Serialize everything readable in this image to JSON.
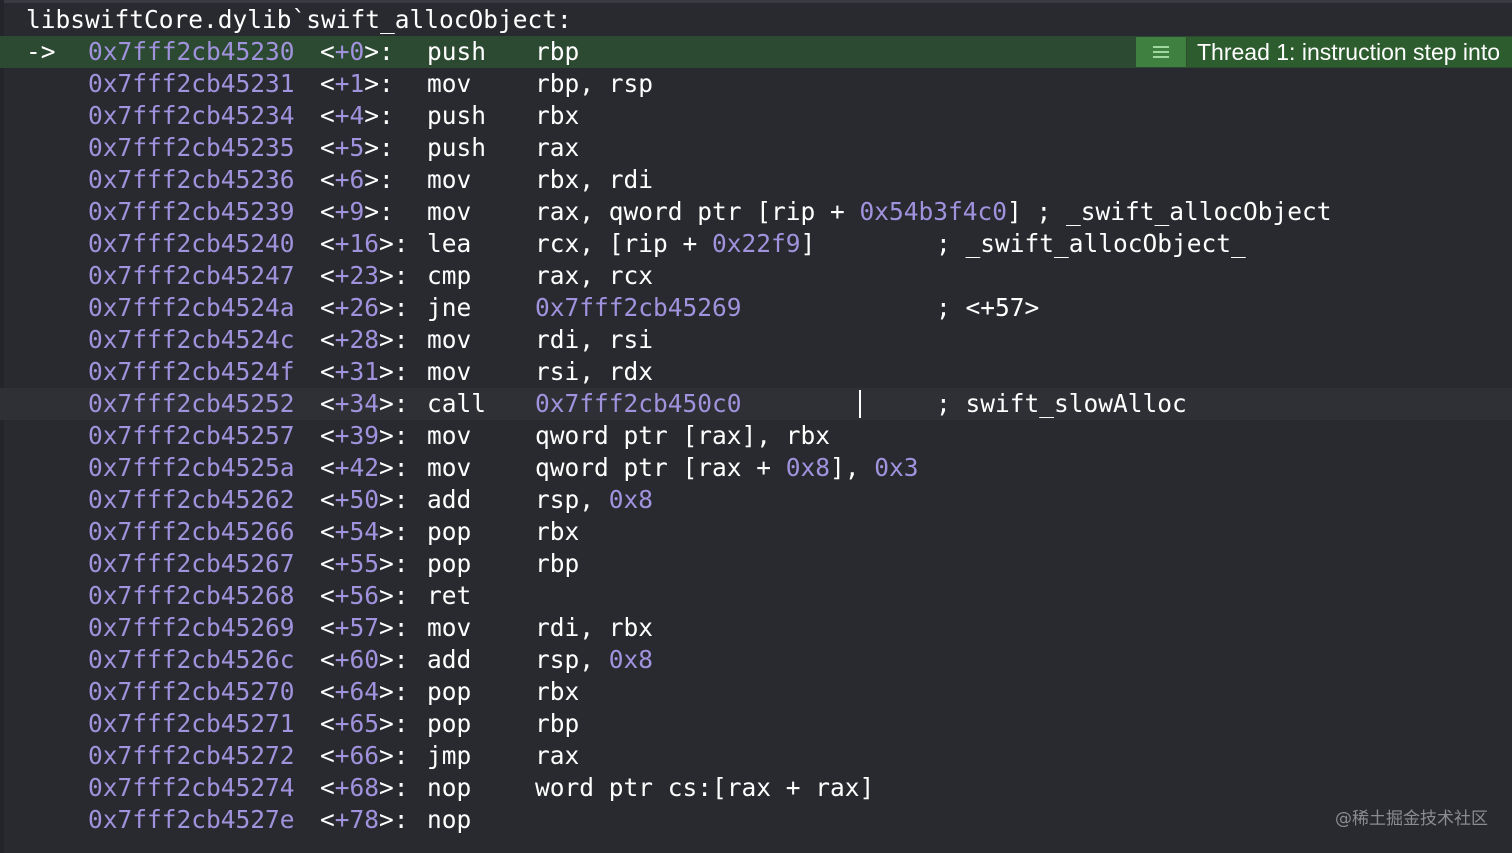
{
  "header": {
    "symbol": "libswiftCore.dylib`swift_allocObject:"
  },
  "badge": {
    "icon": "list-icon",
    "text": "Thread 1: instruction step into"
  },
  "pc_arrow": "->",
  "colors": {
    "background": "#292a30",
    "number": "#a092dd",
    "pc_line": "#2c4a32",
    "badge": "#2d5d2e",
    "current_line": "#2f3036"
  },
  "lines": [
    {
      "addr": "0x7fff2cb45230",
      "lt": "<",
      "off": "+0",
      "gt": ">:",
      "mn": "push",
      "ops": [
        [
          "rbp",
          0
        ]
      ],
      "cmt": ""
    },
    {
      "addr": "0x7fff2cb45231",
      "lt": "<",
      "off": "+1",
      "gt": ">:",
      "mn": "mov",
      "ops": [
        [
          "rbp, rsp",
          0
        ]
      ],
      "cmt": ""
    },
    {
      "addr": "0x7fff2cb45234",
      "lt": "<",
      "off": "+4",
      "gt": ">:",
      "mn": "push",
      "ops": [
        [
          "rbx",
          0
        ]
      ],
      "cmt": ""
    },
    {
      "addr": "0x7fff2cb45235",
      "lt": "<",
      "off": "+5",
      "gt": ">:",
      "mn": "push",
      "ops": [
        [
          "rax",
          0
        ]
      ],
      "cmt": ""
    },
    {
      "addr": "0x7fff2cb45236",
      "lt": "<",
      "off": "+6",
      "gt": ">:",
      "mn": "mov",
      "ops": [
        [
          "rbx, rdi",
          0
        ]
      ],
      "cmt": ""
    },
    {
      "addr": "0x7fff2cb45239",
      "lt": "<",
      "off": "+9",
      "gt": ">:",
      "mn": "mov",
      "ops": [
        [
          "rax, qword ptr [rip + ",
          0
        ],
        [
          "0x54b3f4c0",
          1
        ],
        [
          "] ; _swift_allocObject",
          0
        ]
      ],
      "cmt": ""
    },
    {
      "addr": "0x7fff2cb45240",
      "lt": "<",
      "off": "+16",
      "gt": ">:",
      "mn": "lea",
      "ops": [
        [
          "rcx, [rip + ",
          0
        ],
        [
          "0x22f9",
          1
        ],
        [
          "]",
          0
        ]
      ],
      "cmt": "; _swift_allocObject_"
    },
    {
      "addr": "0x7fff2cb45247",
      "lt": "<",
      "off": "+23",
      "gt": ">:",
      "mn": "cmp",
      "ops": [
        [
          "rax, rcx",
          0
        ]
      ],
      "cmt": ""
    },
    {
      "addr": "0x7fff2cb4524a",
      "lt": "<",
      "off": "+26",
      "gt": ">:",
      "mn": "jne",
      "ops": [
        [
          "0x7fff2cb45269",
          1
        ]
      ],
      "cmt": "; <+57>"
    },
    {
      "addr": "0x7fff2cb4524c",
      "lt": "<",
      "off": "+28",
      "gt": ">:",
      "mn": "mov",
      "ops": [
        [
          "rdi, rsi",
          0
        ]
      ],
      "cmt": ""
    },
    {
      "addr": "0x7fff2cb4524f",
      "lt": "<",
      "off": "+31",
      "gt": ">:",
      "mn": "mov",
      "ops": [
        [
          "rsi, rdx",
          0
        ]
      ],
      "cmt": ""
    },
    {
      "addr": "0x7fff2cb45252",
      "lt": "<",
      "off": "+34",
      "gt": ">:",
      "mn": "call",
      "ops": [
        [
          "0x7fff2cb450c0",
          1
        ]
      ],
      "cmt": "; swift_slowAlloc"
    },
    {
      "addr": "0x7fff2cb45257",
      "lt": "<",
      "off": "+39",
      "gt": ">:",
      "mn": "mov",
      "ops": [
        [
          "qword ptr [rax], rbx",
          0
        ]
      ],
      "cmt": ""
    },
    {
      "addr": "0x7fff2cb4525a",
      "lt": "<",
      "off": "+42",
      "gt": ">:",
      "mn": "mov",
      "ops": [
        [
          "qword ptr [rax + ",
          0
        ],
        [
          "0x8",
          1
        ],
        [
          "], ",
          0
        ],
        [
          "0x3",
          1
        ]
      ],
      "cmt": ""
    },
    {
      "addr": "0x7fff2cb45262",
      "lt": "<",
      "off": "+50",
      "gt": ">:",
      "mn": "add",
      "ops": [
        [
          "rsp, ",
          0
        ],
        [
          "0x8",
          1
        ]
      ],
      "cmt": ""
    },
    {
      "addr": "0x7fff2cb45266",
      "lt": "<",
      "off": "+54",
      "gt": ">:",
      "mn": "pop",
      "ops": [
        [
          "rbx",
          0
        ]
      ],
      "cmt": ""
    },
    {
      "addr": "0x7fff2cb45267",
      "lt": "<",
      "off": "+55",
      "gt": ">:",
      "mn": "pop",
      "ops": [
        [
          "rbp",
          0
        ]
      ],
      "cmt": ""
    },
    {
      "addr": "0x7fff2cb45268",
      "lt": "<",
      "off": "+56",
      "gt": ">:",
      "mn": "ret",
      "ops": [],
      "cmt": ""
    },
    {
      "addr": "0x7fff2cb45269",
      "lt": "<",
      "off": "+57",
      "gt": ">:",
      "mn": "mov",
      "ops": [
        [
          "rdi, rbx",
          0
        ]
      ],
      "cmt": ""
    },
    {
      "addr": "0x7fff2cb4526c",
      "lt": "<",
      "off": "+60",
      "gt": ">:",
      "mn": "add",
      "ops": [
        [
          "rsp, ",
          0
        ],
        [
          "0x8",
          1
        ]
      ],
      "cmt": ""
    },
    {
      "addr": "0x7fff2cb45270",
      "lt": "<",
      "off": "+64",
      "gt": ">:",
      "mn": "pop",
      "ops": [
        [
          "rbx",
          0
        ]
      ],
      "cmt": ""
    },
    {
      "addr": "0x7fff2cb45271",
      "lt": "<",
      "off": "+65",
      "gt": ">:",
      "mn": "pop",
      "ops": [
        [
          "rbp",
          0
        ]
      ],
      "cmt": ""
    },
    {
      "addr": "0x7fff2cb45272",
      "lt": "<",
      "off": "+66",
      "gt": ">:",
      "mn": "jmp",
      "ops": [
        [
          "rax",
          0
        ]
      ],
      "cmt": ""
    },
    {
      "addr": "0x7fff2cb45274",
      "lt": "<",
      "off": "+68",
      "gt": ">:",
      "mn": "nop",
      "ops": [
        [
          "word ptr cs:[rax + rax]",
          0
        ]
      ],
      "cmt": ""
    },
    {
      "addr": "0x7fff2cb4527e",
      "lt": "<",
      "off": "+78",
      "gt": ">:",
      "mn": "nop",
      "ops": [],
      "cmt": ""
    }
  ],
  "watermark": "@稀土掘金技术社区"
}
